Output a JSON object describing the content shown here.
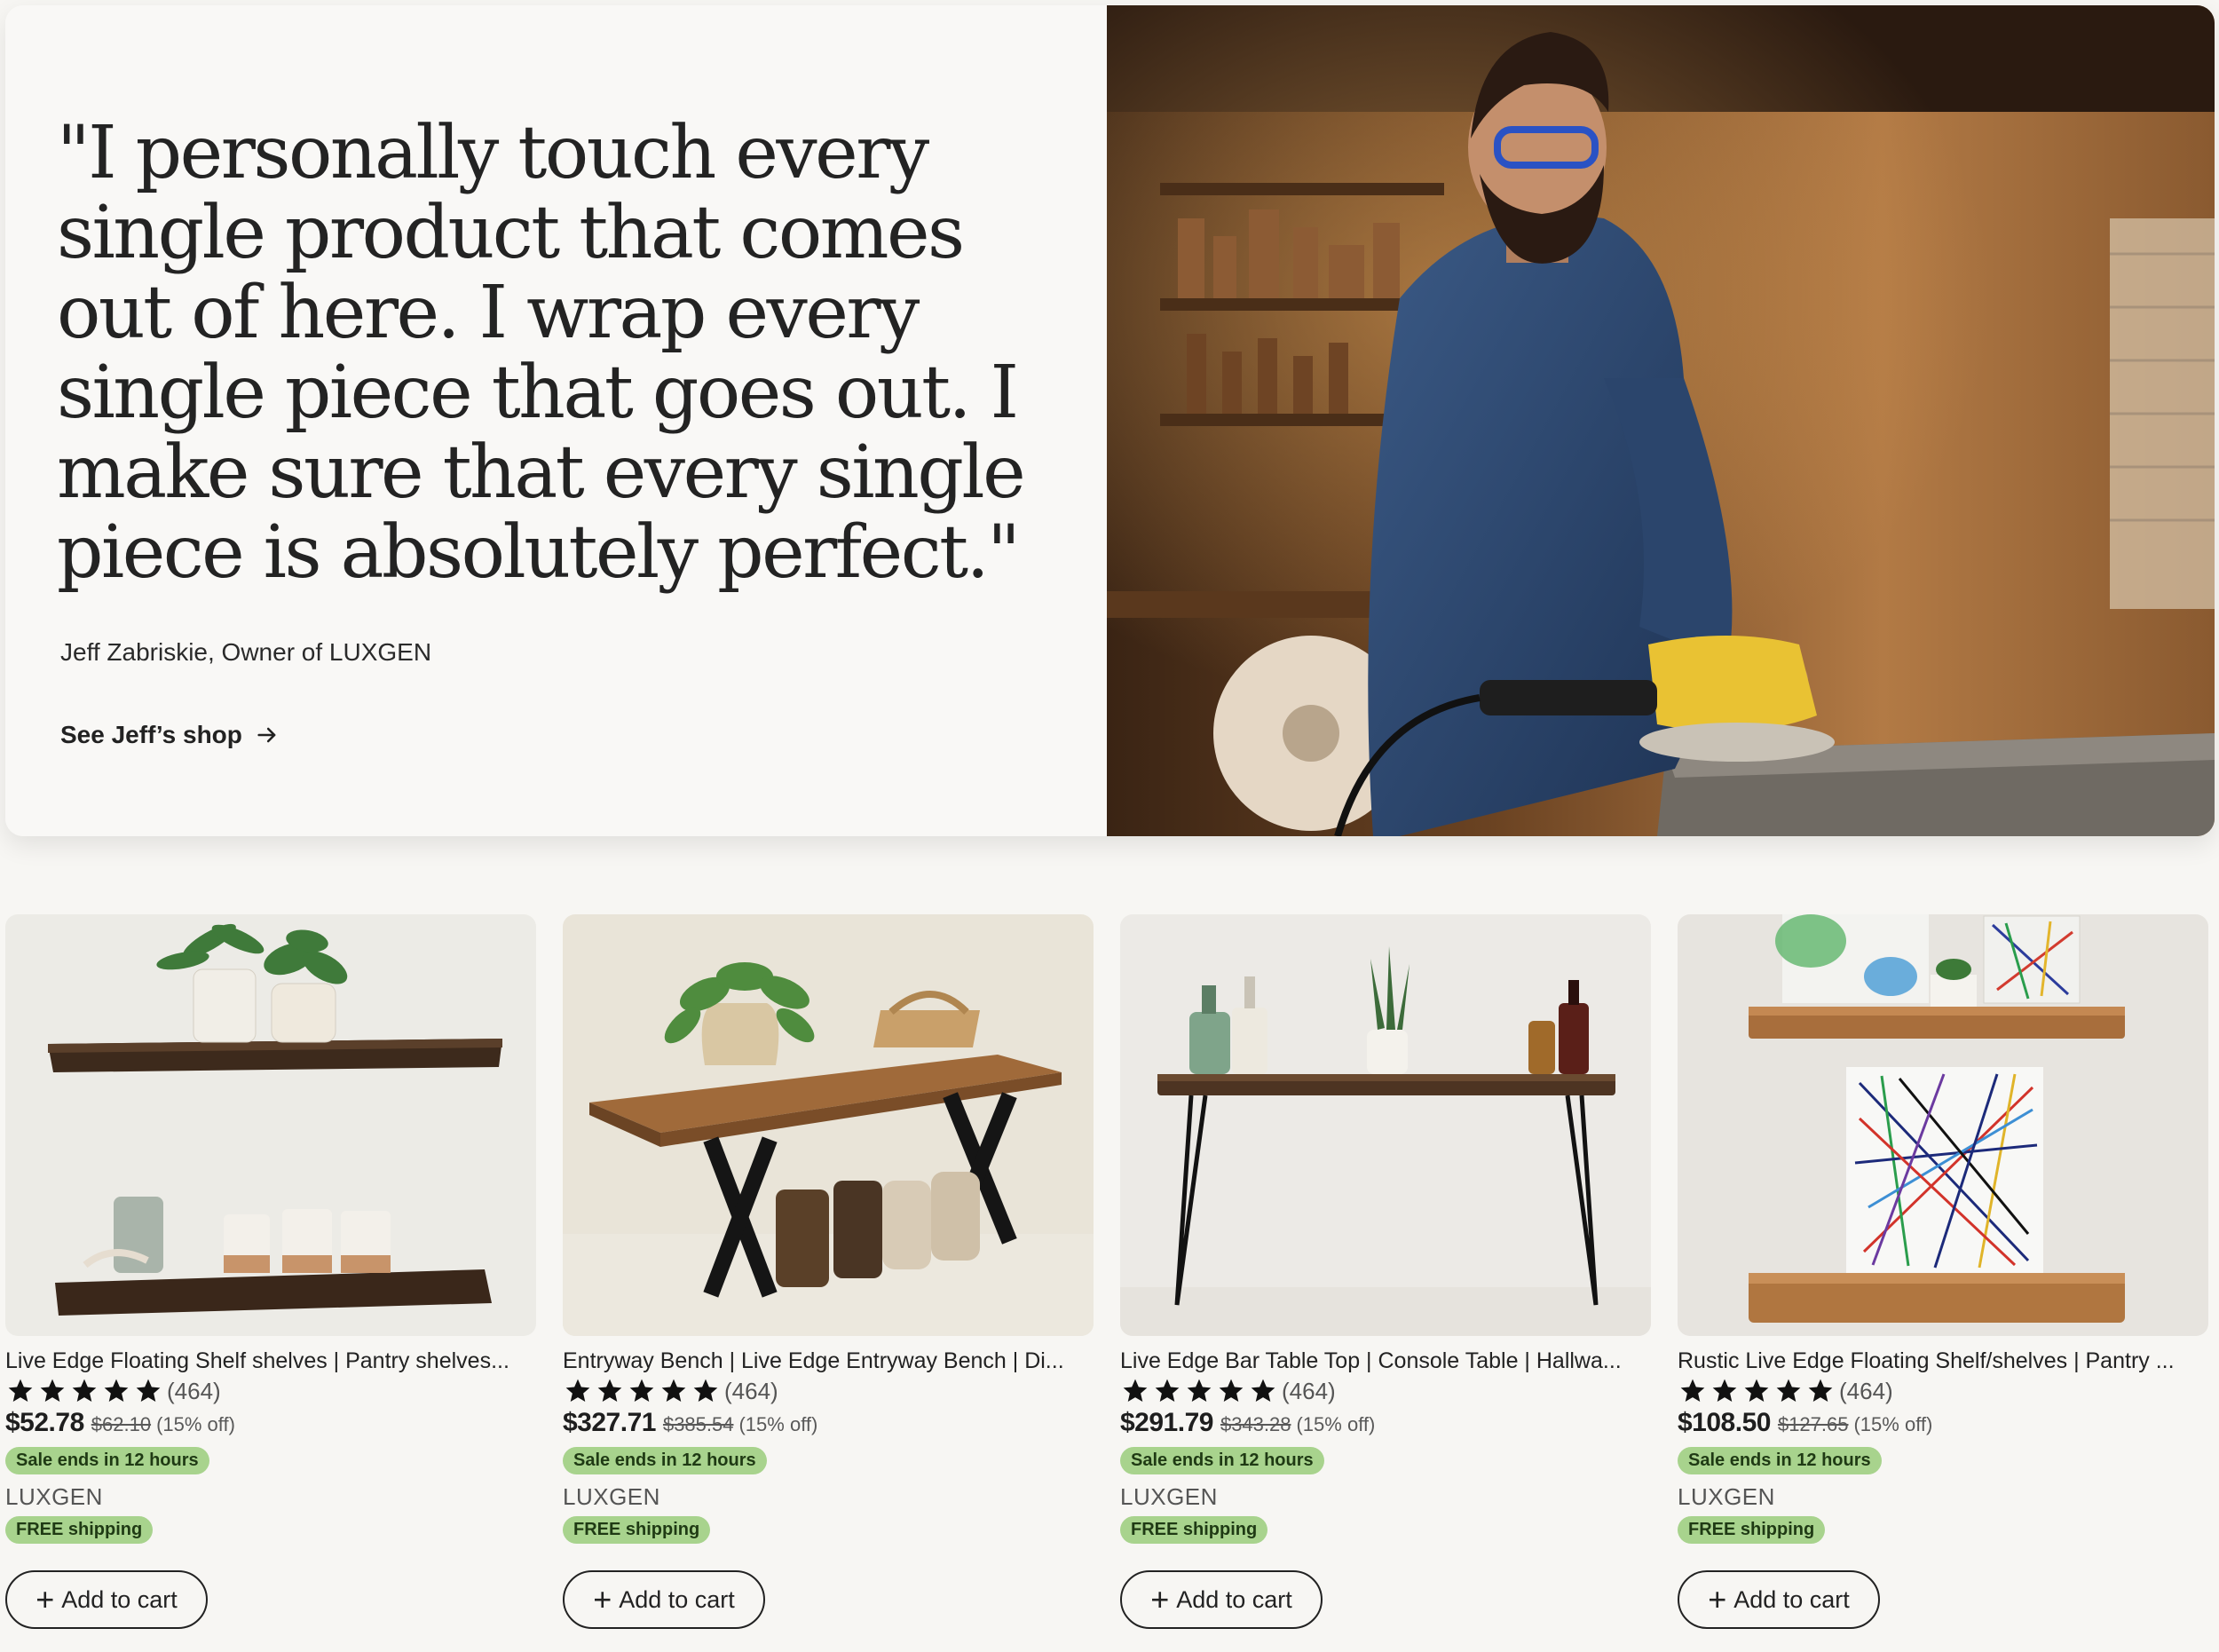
{
  "hero": {
    "quote": "\"I personally touch every single product that comes out of here. I wrap every single piece that goes out. I make sure that every single piece is absolutely perfect.\"",
    "attribution": "Jeff Zabriskie, Owner of LUXGEN",
    "link_label": "See Jeff’s shop",
    "link_icon": "arrow-right-icon",
    "image": "craftsman-sanding-wood-photo"
  },
  "products": [
    {
      "title": "Live Edge Floating Shelf shelves | Pantry shelves...",
      "reviews": "(464)",
      "rating": 5,
      "price": "$52.78",
      "original_price": "$62.10",
      "discount": "(15% off)",
      "sale_badge": "Sale ends in 12 hours",
      "shop": "LUXGEN",
      "shipping_badge": "FREE shipping",
      "cart_label": "Add to cart",
      "image": "floating-shelves-photo"
    },
    {
      "title": "Entryway Bench | Live Edge Entryway Bench | Di...",
      "reviews": "(464)",
      "rating": 5,
      "price": "$327.71",
      "original_price": "$385.54",
      "discount": "(15% off)",
      "sale_badge": "Sale ends in 12 hours",
      "shop": "LUXGEN",
      "shipping_badge": "FREE shipping",
      "cart_label": "Add to cart",
      "image": "entryway-bench-photo"
    },
    {
      "title": "Live Edge Bar Table Top | Console Table | Hallwa...",
      "reviews": "(464)",
      "rating": 5,
      "price": "$291.79",
      "original_price": "$343.28",
      "discount": "(15% off)",
      "sale_badge": "Sale ends in 12 hours",
      "shop": "LUXGEN",
      "shipping_badge": "FREE shipping",
      "cart_label": "Add to cart",
      "image": "console-table-photo"
    },
    {
      "title": "Rustic Live Edge Floating Shelf/shelves | Pantry ...",
      "reviews": "(464)",
      "rating": 5,
      "price": "$108.50",
      "original_price": "$127.65",
      "discount": "(15% off)",
      "sale_badge": "Sale ends in 12 hours",
      "shop": "LUXGEN",
      "shipping_badge": "FREE shipping",
      "cart_label": "Add to cart",
      "image": "rustic-shelves-photo"
    }
  ],
  "colors": {
    "badge_green": "#a8d38d",
    "page_bg": "#f7f6f3",
    "text": "#222222"
  }
}
